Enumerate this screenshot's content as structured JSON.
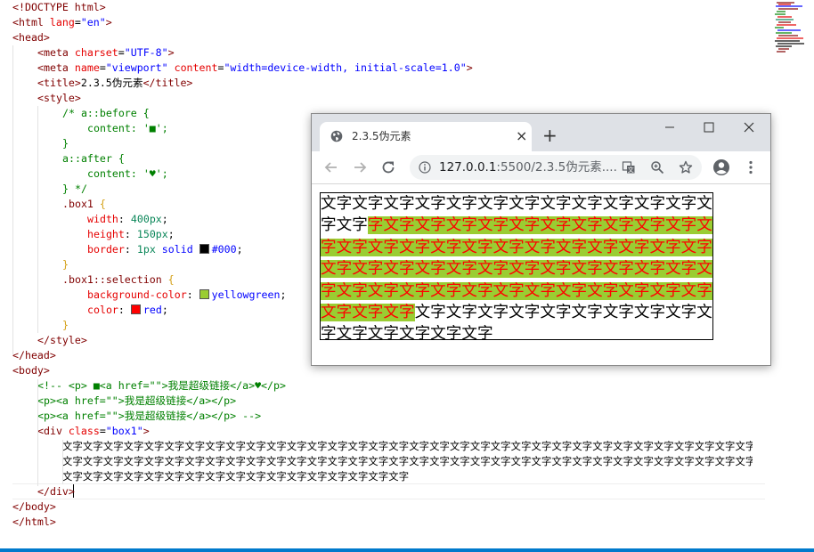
{
  "editor": {
    "lines": [
      [
        [
          "t-tag",
          "<!DOCTYPE html>"
        ]
      ],
      [
        [
          "t-tag",
          "<html "
        ],
        [
          "t-attr",
          "lang"
        ],
        [
          "t-txt",
          "="
        ],
        [
          "t-val",
          "\"en\""
        ],
        [
          "t-tag",
          ">"
        ]
      ],
      [
        [
          "t-tag",
          "<head>"
        ]
      ],
      [
        [
          "t-tag",
          "<meta "
        ],
        [
          "t-attr",
          "charset"
        ],
        [
          "t-txt",
          "="
        ],
        [
          "t-val",
          "\"UTF-8\""
        ],
        [
          "t-tag",
          ">"
        ]
      ],
      [
        [
          "t-tag",
          "<meta "
        ],
        [
          "t-attr",
          "name"
        ],
        [
          "t-txt",
          "="
        ],
        [
          "t-val",
          "\"viewport\""
        ],
        [
          "t-txt",
          " "
        ],
        [
          "t-attr",
          "content"
        ],
        [
          "t-txt",
          "="
        ],
        [
          "t-val",
          "\"width=device-width, initial-scale=1.0\""
        ],
        [
          "t-tag",
          ">"
        ]
      ],
      [
        [
          "t-tag",
          "<title>"
        ],
        [
          "t-txt",
          "2.3.5伪元素"
        ],
        [
          "t-tag",
          "</title>"
        ]
      ],
      [
        [
          "t-tag",
          "<style>"
        ]
      ],
      [
        [
          "t-cmt",
          "/* a::before {"
        ]
      ],
      [
        [
          "t-cmt",
          "content: '■';"
        ]
      ],
      [
        [
          "t-cmt",
          "}"
        ]
      ],
      [
        [
          "t-cmt",
          "a::after {"
        ]
      ],
      [
        [
          "t-cmt",
          "content: '♥';"
        ]
      ],
      [
        [
          "t-cmt",
          "} */"
        ]
      ],
      [
        [
          "t-sel",
          ".box1"
        ],
        [
          "t-brace-y",
          " {"
        ]
      ],
      [
        [
          "t-prop",
          "width"
        ],
        [
          "t-txt",
          ": "
        ],
        [
          "t-num",
          "400px"
        ],
        [
          "t-txt",
          ";"
        ]
      ],
      [
        [
          "t-prop",
          "height"
        ],
        [
          "t-txt",
          ": "
        ],
        [
          "t-num",
          "150px"
        ],
        [
          "t-txt",
          ";"
        ]
      ],
      [
        [
          "t-prop",
          "border"
        ],
        [
          "t-txt",
          ": "
        ],
        [
          "t-num",
          "1px"
        ],
        [
          "t-txt",
          " "
        ],
        [
          "t-val",
          "solid"
        ],
        [
          "t-txt",
          " "
        ],
        [
          "swatch",
          "#000000"
        ],
        [
          "t-val",
          "#000"
        ],
        [
          "t-txt",
          ";"
        ]
      ],
      [
        [
          "t-brace-y",
          "}"
        ]
      ],
      [
        [
          "t-sel",
          ".box1::selection"
        ],
        [
          "t-brace-y",
          " {"
        ]
      ],
      [
        [
          "t-prop",
          "background-color"
        ],
        [
          "t-txt",
          ": "
        ],
        [
          "swatch",
          "#9acd32"
        ],
        [
          "t-val",
          "yellowgreen"
        ],
        [
          "t-txt",
          ";"
        ]
      ],
      [
        [
          "t-prop",
          "color"
        ],
        [
          "t-txt",
          ": "
        ],
        [
          "swatch",
          "#ff0000"
        ],
        [
          "t-val",
          "red"
        ],
        [
          "t-txt",
          ";"
        ]
      ],
      [
        [
          "t-brace-y",
          "}"
        ]
      ],
      [
        [
          "t-tag",
          "</style>"
        ]
      ],
      [
        [
          "t-tag",
          "</head>"
        ]
      ],
      [
        [
          "t-tag",
          "<body>"
        ]
      ],
      [
        [
          "t-cmt",
          "<!-- <p> ■<a href=\"\">我是超级链接</a>♥</p>"
        ]
      ],
      [
        [
          "t-cmt",
          "<p><a href=\"\">我是超级链接</a></p>"
        ]
      ],
      [
        [
          "t-cmt",
          "<p><a href=\"\">我是超级链接</a></p> -->"
        ]
      ],
      [
        [
          "t-tag",
          "<div "
        ],
        [
          "t-attr",
          "class"
        ],
        [
          "t-txt",
          "="
        ],
        [
          "t-val",
          "\"box1\""
        ],
        [
          "t-tag",
          ">"
        ]
      ],
      [
        [
          "t-txt",
          "文字文字文字文字文字文字文字文字文字文字文字文字文字文字文字文字文字文字文字文字文字文字文字文字文字文字文字文字文字文字文字文字文字文字文字文字文字文字文字文字文字文字文字文字文字文字文字文字文字文字文字文字文字文字文字文字文字文字文字文字文字文字"
        ]
      ],
      [
        [
          "t-txt",
          "文字文字文字文字文字文字文字文字文字文字文字文字文字文字文字文字文字文字文字文字文字文字文字文字文字文字文字文字文字文字文字文字文字文字文字文字文字文字文字文字文字文字文字文字文字文字文字文字文字文字文字文字文字文字文字文字文字文字文字文字文字文字"
        ]
      ],
      [
        [
          "t-txt",
          "文字文字文字文字文字文字文字文字文字文字文字文字文字文字文字文字文字文字文字文字文字文字文字文字文字文字文字文字文字文字文字文字文字文字文字文字文字文字文字文字文字文字文字文字文字文字文字文字文字文字文字文字文字文字文字文字文字文字文字文字文字文字"
        ]
      ],
      [
        [
          "t-tag",
          "</div>"
        ]
      ],
      [
        [
          "t-tag",
          "</body>"
        ]
      ],
      [
        [
          "t-tag",
          "</html>"
        ]
      ]
    ],
    "body_text_lines": [
      "文字文字文字文字文字文字文字文字文字文字文字文字文字文字文字文字文字文字文字文字文字文字文字文字文字文字文字文字文字文字文字文字文字文字文字文字文字文字文字文字文字文字文字文字文字文字文字文字文字文字文字文字文字文字文字文字文字文字文字文字文字文字文字文字文字",
      "文字文字文字文字文字文字文字文字文字文字文字文字文字文字文字文字文字文字文字文字文字文字文字文字文字文字文字文字文字文字文字文字文字文字文字文字文字文字文字文字文字文字文字文字文字文字文字文字文字文字文字文字文字文字文字文字文字文字文字文字文字文字文字文字文字",
      "文字文字文字文字文字文字文字文字文字文字文字文字文字文字文字文字文字"
    ],
    "colors": {
      "status_bar": "#007acc",
      "selection_bg": "#9acd32",
      "selection_text": "#ff0000"
    }
  },
  "browser": {
    "tab_title": "2.3.5伪元素",
    "tab_close": "×",
    "new_tab": "+",
    "url_host": "127.0.0.1",
    "url_path": ":5500/2.3.5伪元素....",
    "box_text_before": "文字文字文字文字文字文字文字文字文字文字文字文字文字文字",
    "box_text_selected": "字文字文字文字文字文字文字文字文字文字文字文字文字文字文字文字文字文字文字文字文字文字文字文字文字文字文字文字文字文字文字文字文字文字文字文字文字文字文字文字文字文字文字文字文字文字文字文字文字文字文字文字",
    "box_text_after": "文字文字文字文字文字文字文字文字文字文字文字文字文字文字文字"
  }
}
